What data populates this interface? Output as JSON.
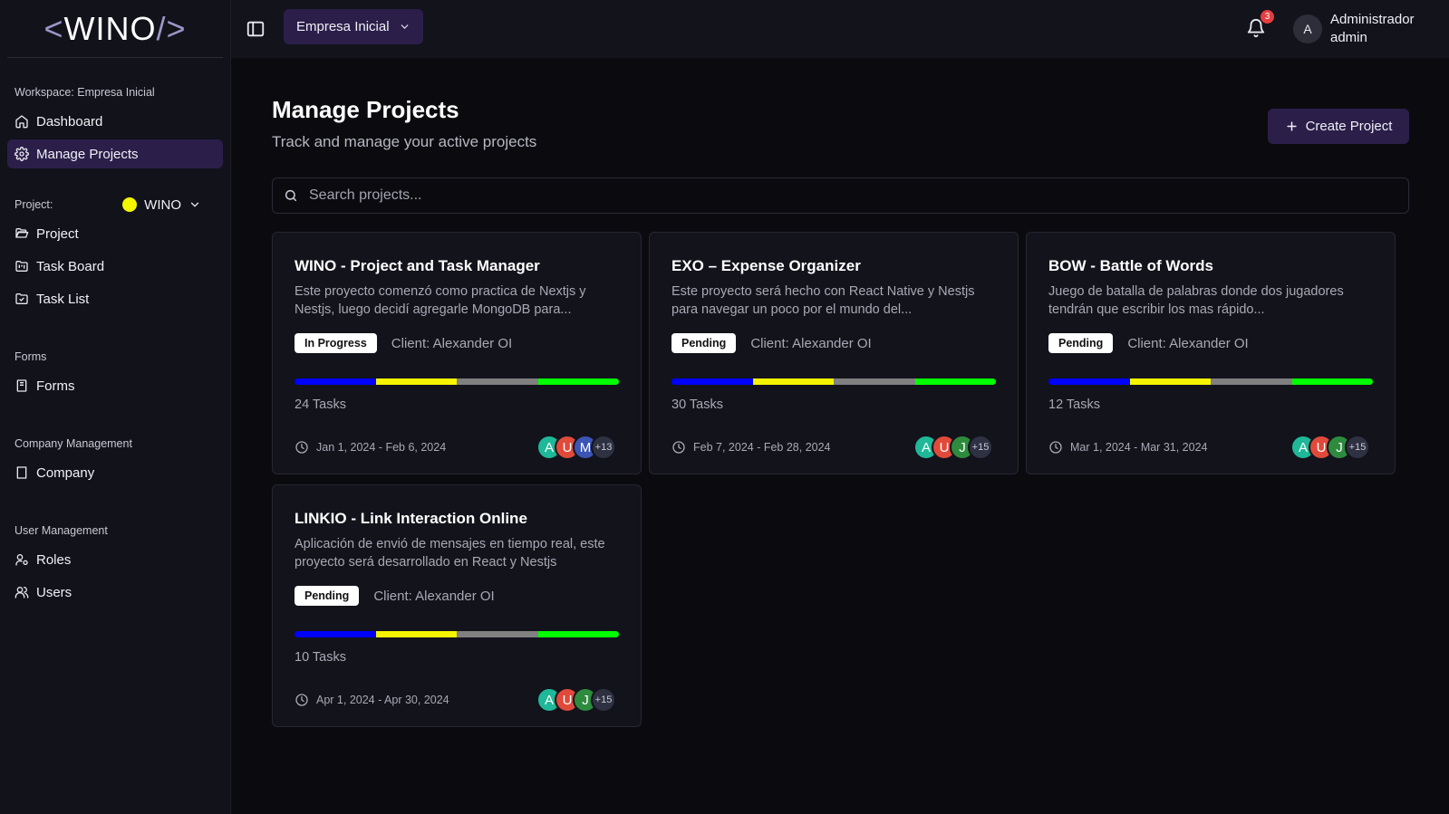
{
  "brand": {
    "logo_left": "<",
    "logo_text": "WINO",
    "logo_right": "/>"
  },
  "sidebar": {
    "workspace_label": "Workspace: Empresa Inicial",
    "workspace_items": [
      {
        "label": "Dashboard",
        "icon": "home-icon"
      },
      {
        "label": "Manage Projects",
        "icon": "gear-icon",
        "active": true
      }
    ],
    "project_label": "Project:",
    "project_selected": "WINO",
    "project_color": "#f5f500",
    "project_items": [
      {
        "label": "Project",
        "icon": "folder-open-icon"
      },
      {
        "label": "Task Board",
        "icon": "folder-kanban-icon"
      },
      {
        "label": "Task List",
        "icon": "folder-check-icon"
      }
    ],
    "forms_label": "Forms",
    "forms_items": [
      {
        "label": "Forms",
        "icon": "form-icon"
      }
    ],
    "company_label": "Company Management",
    "company_items": [
      {
        "label": "Company",
        "icon": "building-icon"
      }
    ],
    "users_label": "User Management",
    "users_items": [
      {
        "label": "Roles",
        "icon": "user-cog-icon"
      },
      {
        "label": "Users",
        "icon": "users-icon"
      }
    ]
  },
  "topbar": {
    "company_selector": "Empresa Inicial",
    "notification_count": "3",
    "user_initial": "A",
    "user_name": "Administrador",
    "user_role": "admin"
  },
  "main": {
    "title": "Manage Projects",
    "subtitle": "Track and manage your active projects",
    "create_button": "Create Project",
    "search_placeholder": "Search projects..."
  },
  "progress_colors": [
    "#0000ff",
    "#f5f500",
    "#808080",
    "#00ff00"
  ],
  "projects": [
    {
      "title": "WINO - Project and Task Manager",
      "description": "Este proyecto comenzó como practica de Nextjs y Nestjs, luego decidí agregarle MongoDB para...",
      "status": "In Progress",
      "client": "Client: Alexander OI",
      "tasks": "24 Tasks",
      "dates": "Jan 1, 2024 - Feb 6, 2024",
      "members": [
        {
          "initial": "A",
          "color": "#1fb898"
        },
        {
          "initial": "U",
          "color": "#e04a3a"
        },
        {
          "initial": "M",
          "color": "#3b55b5"
        }
      ],
      "more": "+13"
    },
    {
      "title": "EXO – Expense Organizer",
      "description": "Este proyecto será hecho con React Native y Nestjs para navegar un poco por el mundo del...",
      "status": "Pending",
      "client": "Client: Alexander OI",
      "tasks": "30 Tasks",
      "dates": "Feb 7, 2024 - Feb 28, 2024",
      "members": [
        {
          "initial": "A",
          "color": "#1fb898"
        },
        {
          "initial": "U",
          "color": "#e04a3a"
        },
        {
          "initial": "J",
          "color": "#2e8b3e"
        }
      ],
      "more": "+15"
    },
    {
      "title": "BOW - Battle of Words",
      "description": "Juego de batalla de palabras donde dos jugadores tendrán que escribir los mas rápido...",
      "status": "Pending",
      "client": "Client: Alexander OI",
      "tasks": "12 Tasks",
      "dates": "Mar 1, 2024 - Mar 31, 2024",
      "members": [
        {
          "initial": "A",
          "color": "#1fb898"
        },
        {
          "initial": "U",
          "color": "#e04a3a"
        },
        {
          "initial": "J",
          "color": "#2e8b3e"
        }
      ],
      "more": "+15"
    },
    {
      "title": "LINKIO - Link Interaction Online",
      "description": "Aplicación de envió de mensajes en tiempo real, este proyecto será desarrollado en React y Nestjs",
      "status": "Pending",
      "client": "Client: Alexander OI",
      "tasks": "10 Tasks",
      "dates": "Apr 1, 2024 - Apr 30, 2024",
      "members": [
        {
          "initial": "A",
          "color": "#1fb898"
        },
        {
          "initial": "U",
          "color": "#e04a3a"
        },
        {
          "initial": "J",
          "color": "#2e8b3e"
        }
      ],
      "more": "+15"
    }
  ]
}
